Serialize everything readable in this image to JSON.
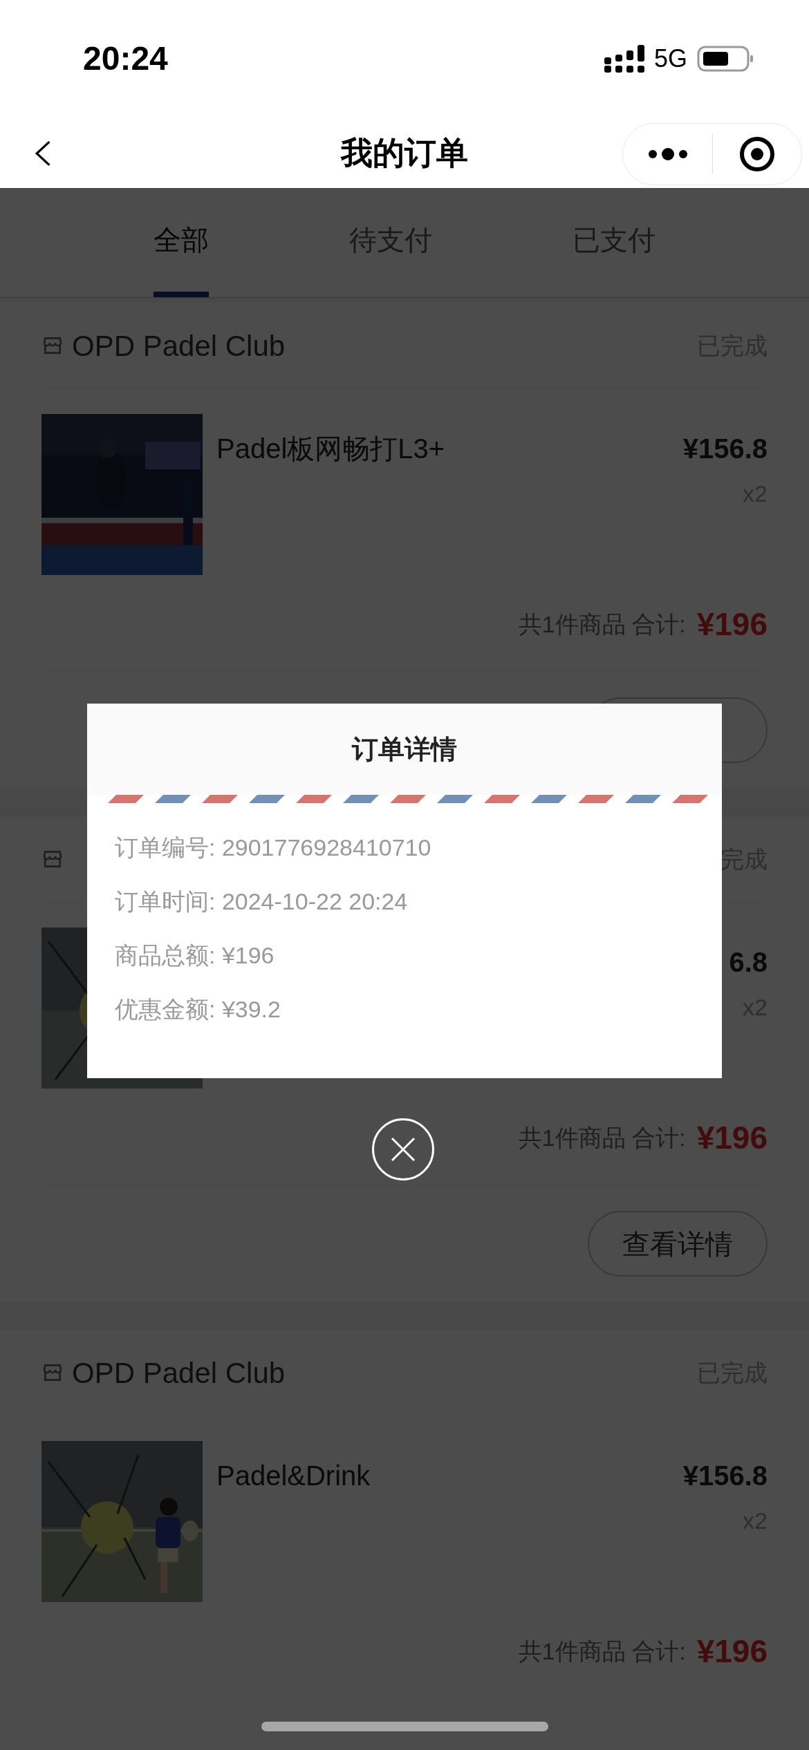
{
  "status_bar": {
    "time": "20:24",
    "network": "5G"
  },
  "nav": {
    "title": "我的订单"
  },
  "tabs": [
    {
      "label": "全部",
      "selected": true
    },
    {
      "label": "待支付",
      "selected": false
    },
    {
      "label": "已支付",
      "selected": false
    }
  ],
  "orders": [
    {
      "shop": "OPD Padel Club",
      "status": "已完成",
      "product": "Padel板网畅打L3+",
      "price": "¥156.8",
      "qty": "x2",
      "summary": "共1件商品 合计:",
      "total": "¥196"
    },
    {
      "status": "完成",
      "price": "6.8",
      "qty": "x2",
      "summary": "共1件商品 合计:",
      "total": "¥196",
      "button": "查看详情"
    },
    {
      "shop": "OPD Padel Club",
      "status": "已完成",
      "product": "Padel&Drink",
      "price": "¥156.8",
      "qty": "x2",
      "summary": "共1件商品 合计:",
      "total": "¥196"
    }
  ],
  "dialog": {
    "title": "订单详情",
    "rows": [
      "订单编号: 2901776928410710",
      "订单时间: 2024-10-22 20:24",
      "商品总额: ¥196",
      "优惠金额: ¥39.2"
    ]
  }
}
